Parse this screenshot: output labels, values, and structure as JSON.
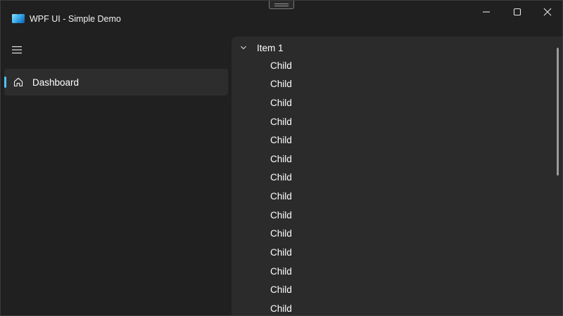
{
  "window": {
    "title": "WPF UI - Simple Demo",
    "logo_icon": "wpf-ui-logo-icon",
    "caption_buttons": [
      "minimize-icon",
      "maximize-icon",
      "close-icon"
    ]
  },
  "nav": {
    "toggle_icon": "hamburger-menu-icon",
    "items": [
      {
        "label": "Dashboard",
        "icon": "home-icon",
        "selected": true
      }
    ],
    "accent_color": "#4cc2ff"
  },
  "tree": {
    "root": {
      "label": "Item 1",
      "expanded": true,
      "icon": "chevron-down-icon"
    },
    "children": [
      "Child",
      "Child",
      "Child",
      "Child",
      "Child",
      "Child",
      "Child",
      "Child",
      "Child",
      "Child",
      "Child",
      "Child",
      "Child",
      "Child"
    ]
  }
}
